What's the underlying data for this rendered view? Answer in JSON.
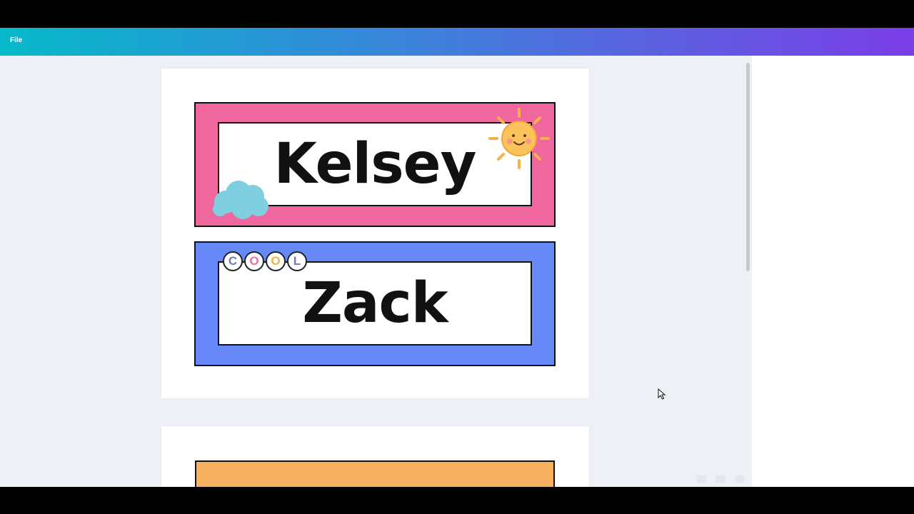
{
  "menu": {
    "file_label": "File"
  },
  "pages": [
    {
      "labels": [
        {
          "name": "Kelsey",
          "color": "#ef679c",
          "stickers": [
            "sun-sticker",
            "cloud-sticker"
          ]
        },
        {
          "name": "Zack",
          "color": "#6689f7",
          "badge_letters": [
            "C",
            "O",
            "O",
            "L"
          ],
          "badge_colors": [
            "#6a7bb5",
            "#ea6fa0",
            "#f3b03e",
            "#6a7bb5"
          ]
        }
      ]
    },
    {
      "labels": [
        {
          "name": "",
          "color": "#f6b05f"
        }
      ]
    }
  ],
  "colors": {
    "topbar_gradient": [
      "#06b9c9",
      "#7a3de6"
    ],
    "workspace": "#edf0f4"
  }
}
